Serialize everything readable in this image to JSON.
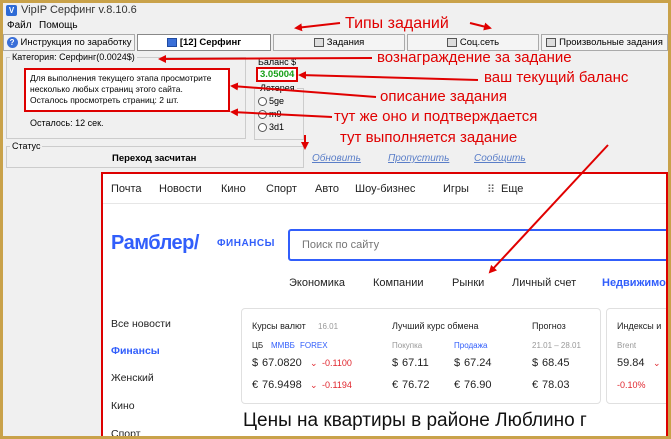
{
  "window": {
    "title": "VipIP Серфинг  v.8.10.6"
  },
  "menu": {
    "items": [
      "Файл",
      "Помощь"
    ]
  },
  "tabs": [
    {
      "label": "Инструкция по заработку"
    },
    {
      "label": "[12] Серфинг"
    },
    {
      "label": "Задания"
    },
    {
      "label": "Соц.сеть"
    },
    {
      "label": "Произвольные задания"
    }
  ],
  "category": {
    "label": "Категория: Серфинг(0.0024$)",
    "description": [
      "Для выполнения текущего этапа просмотрите",
      "несколько любых страниц этого сайта.",
      "Осталось просмотреть страниц: 2 шт."
    ],
    "remaining": "Осталось: 12 сек."
  },
  "balance": {
    "label": "Баланс $",
    "value": "3.05004"
  },
  "lottery": {
    "label": "Лотерея",
    "options": [
      "5ge",
      "m9",
      "3d1"
    ]
  },
  "status": {
    "label": "Статус",
    "text": "Переход засчитан"
  },
  "actions": {
    "refresh": "Обновить",
    "skip": "Пропустить",
    "report": "Сообщить"
  },
  "annotations": {
    "task_types": "Типы заданий",
    "reward": "вознаграждение за задание",
    "balance": "ваш текущий баланс",
    "description": "описание задания",
    "confirm": "тут же оно и подтверждается",
    "execute": "тут выполняется задание"
  },
  "browser": {
    "topnav": [
      "Почта",
      "Новости",
      "Кино",
      "Спорт",
      "Авто",
      "Шоу-бизнес",
      "Игры",
      "Еще"
    ],
    "logo": "Рамблер/",
    "logo_sub": "ФИНАНСЫ",
    "search_placeholder": "Поиск по сайту",
    "subnav": [
      "Экономика",
      "Компании",
      "Рынки",
      "Личный счет",
      "Недвижимо"
    ],
    "sidebar": [
      "Все новости",
      "Финансы",
      "Женский",
      "Кино",
      "Спорт"
    ],
    "rates": {
      "title": "Курсы валют",
      "date": "16.01",
      "sources": [
        "ЦБ",
        "ММВБ",
        "FOREX"
      ],
      "usd": "67.0820",
      "usd_change": "-0.1100",
      "eur": "76.9498",
      "eur_change": "-0.1194"
    },
    "exchange": {
      "title": "Лучший курс обмена",
      "buy_label": "Покупка",
      "sell_label": "Продажа",
      "usd_buy": "67.11",
      "usd_sell": "67.24",
      "eur_buy": "76.72",
      "eur_sell": "76.90"
    },
    "forecast": {
      "title": "Прогноз",
      "range": "21.01 – 28.01",
      "usd": "68.45",
      "eur": "78.03"
    },
    "indices": {
      "title": "Индексы и",
      "name": "Brent",
      "value": "59.84",
      "change": "-0.10%"
    },
    "headline": "Цены на квартиры в районе Люблино г"
  }
}
